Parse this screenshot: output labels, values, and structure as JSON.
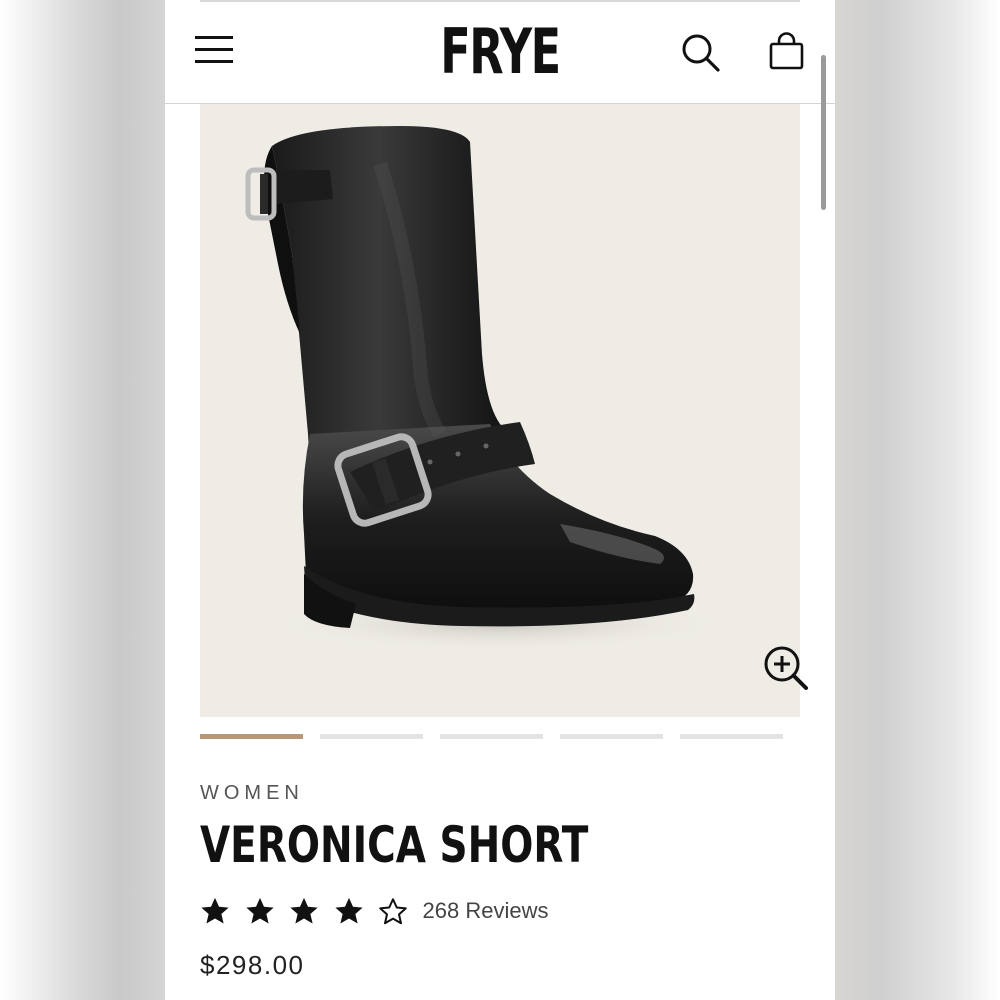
{
  "header": {
    "logo": "FRYE",
    "menu_icon": "hamburger-menu-icon",
    "search_icon": "search-icon",
    "cart_icon": "shopping-bag-icon"
  },
  "product": {
    "image_subject": "boot-image",
    "zoom_icon": "zoom-in-icon",
    "carousel": {
      "total": 5,
      "active": 1
    },
    "category": "WOMEN",
    "name": "VERONICA SHORT",
    "rating": 4,
    "rating_max": 5,
    "reviews_label": "268 Reviews",
    "price": "$298.00"
  },
  "colors": {
    "accent": "#b89777",
    "image_bg": "#efece6",
    "text": "#111111"
  }
}
